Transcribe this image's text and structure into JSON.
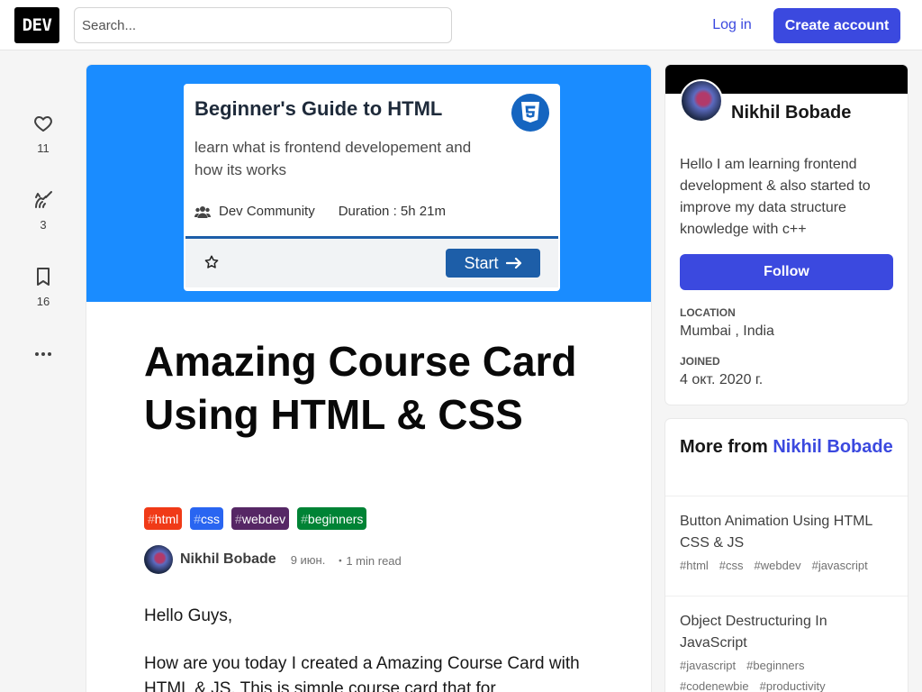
{
  "header": {
    "logo": "DEV",
    "search_placeholder": "Search...",
    "login": "Log in",
    "create_account": "Create account"
  },
  "actions": {
    "likes": "11",
    "unicorns": "3",
    "bookmarks": "16"
  },
  "cover": {
    "title": "Beginner's Guide to HTML",
    "description": "learn what is frontend developement and how its works",
    "community": "Dev Community",
    "duration": "Duration : 5h 21m",
    "start": "Start"
  },
  "article": {
    "title": "Amazing Course Card Using HTML & CSS",
    "tags": [
      {
        "label": "html",
        "color": "#f03a17"
      },
      {
        "label": "css",
        "color": "#2965f1"
      },
      {
        "label": "webdev",
        "color": "#562765"
      },
      {
        "label": "beginners",
        "color": "#008335"
      }
    ],
    "author": "Nikhil Bobade",
    "date": "9 июн.",
    "read_time": "・1 min read",
    "paragraph1": "Hello Guys,",
    "paragraph2": "How are you today I created a Amazing Course Card with HTML & JS. This is simple course card that for"
  },
  "sidebar": {
    "name": "Nikhil Bobade",
    "bio": "Hello I am learning frontend development & also started to improve my data structure knowledge with c++",
    "follow": "Follow",
    "location_label": "LOCATION",
    "location": "Mumbai , India",
    "joined_label": "JOINED",
    "joined": "4 окт. 2020 г."
  },
  "more": {
    "heading_prefix": "More from",
    "heading_name": "Nikhil Bobade",
    "items": [
      {
        "title": "Button Animation Using HTML CSS & JS",
        "tags": [
          "html",
          "css",
          "webdev",
          "javascript"
        ]
      },
      {
        "title": "Object Destructuring In JavaScript",
        "tags": [
          "javascript",
          "beginners"
        ]
      },
      {
        "title": "",
        "tags": [
          "codenewbie",
          "productivity"
        ]
      }
    ]
  },
  "colors": {
    "accent": "#3b49df",
    "cover_bg": "#1a8cff"
  }
}
